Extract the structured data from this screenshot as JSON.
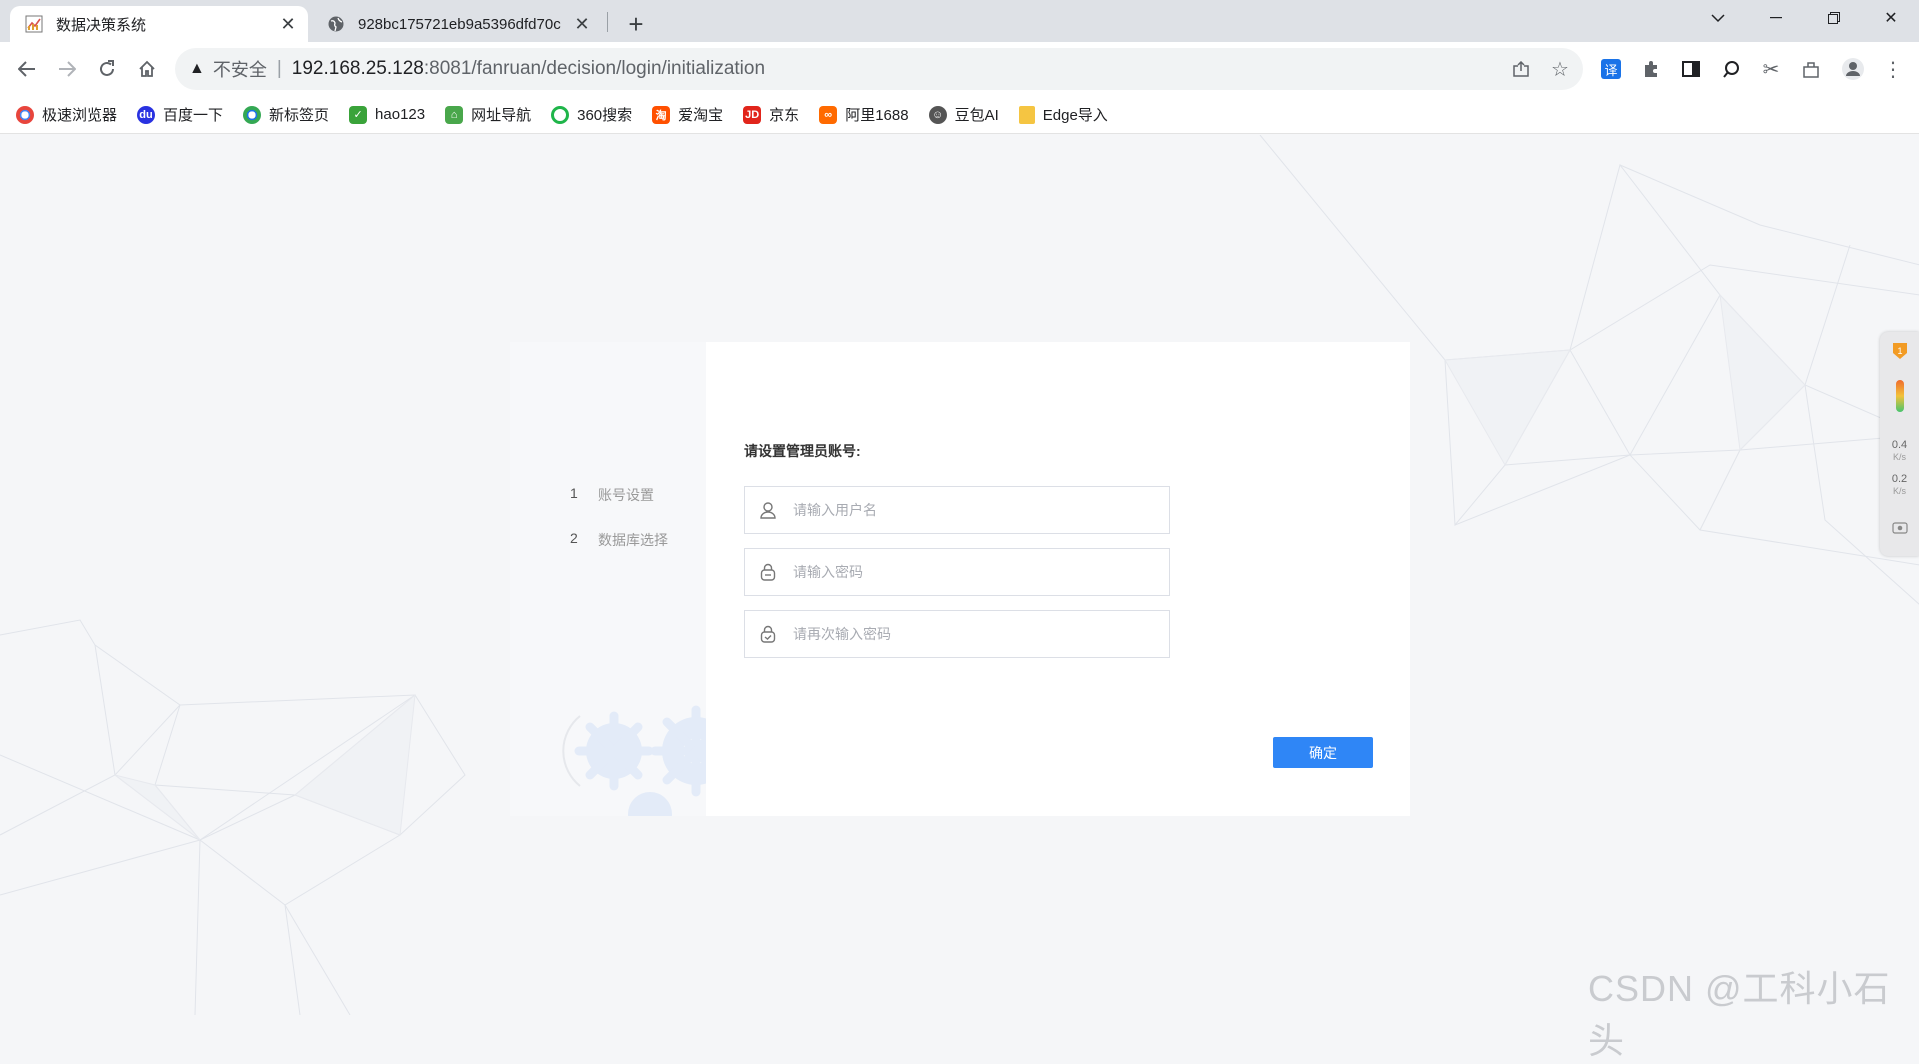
{
  "tabs": [
    {
      "title": "数据决策系统",
      "active": true
    },
    {
      "title": "928bc175721eb9a5396dfd70c"
    }
  ],
  "address": {
    "insecure_label": "不安全",
    "host": "192.168.25.128",
    "path": ":8081/fanruan/decision/login/initialization"
  },
  "bookmarks": [
    {
      "label": "极速浏览器",
      "color": "#e8453c"
    },
    {
      "label": "百度一下",
      "color": "#2932e1"
    },
    {
      "label": "新标签页",
      "color": "#1a73e8"
    },
    {
      "label": "hao123",
      "color": "#3aa33a"
    },
    {
      "label": "网址导航",
      "color": "#49a74b"
    },
    {
      "label": "360搜索",
      "color": "#1fb54a"
    },
    {
      "label": "爱淘宝",
      "color": "#ff5000"
    },
    {
      "label": "京东",
      "color": "#e1251b"
    },
    {
      "label": "阿里1688",
      "color": "#ff6a00"
    },
    {
      "label": "豆包AI",
      "color": "#555555"
    },
    {
      "label": "Edge导入",
      "color": "#f5c542"
    }
  ],
  "steps": [
    {
      "num": "1",
      "label": "账号设置"
    },
    {
      "num": "2",
      "label": "数据库选择"
    }
  ],
  "form": {
    "title": "请设置管理员账号:",
    "username_placeholder": "请输入用户名",
    "password_placeholder": "请输入密码",
    "password_confirm_placeholder": "请再次输入密码",
    "confirm_label": "确定"
  },
  "side_widget": {
    "upload_speed": "0.4",
    "download_speed": "0.2",
    "unit": "K/s"
  },
  "watermark": "CSDN @工科小石头",
  "colors": {
    "accent": "#2f86f6",
    "page_bg": "#f5f6f8"
  }
}
